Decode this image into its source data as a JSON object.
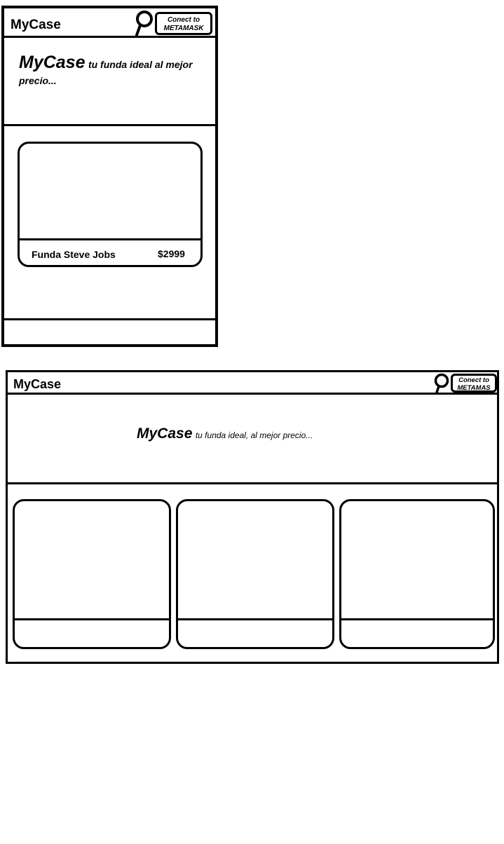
{
  "brand": "MyCase",
  "connect_button": {
    "line1": "Conect to",
    "line2_mobile": "METAMASK",
    "line2_desktop": "METAMAS"
  },
  "mobile": {
    "hero_title": "MyCase",
    "hero_tagline": "tu funda ideal al mejor precio...",
    "products": [
      {
        "name": "Funda Steve Jobs",
        "price": "$2999"
      }
    ]
  },
  "desktop": {
    "hero_title": "MyCase",
    "hero_tagline": "tu funda ideal, al mejor precio..."
  },
  "icons": {
    "search": "search-icon"
  }
}
